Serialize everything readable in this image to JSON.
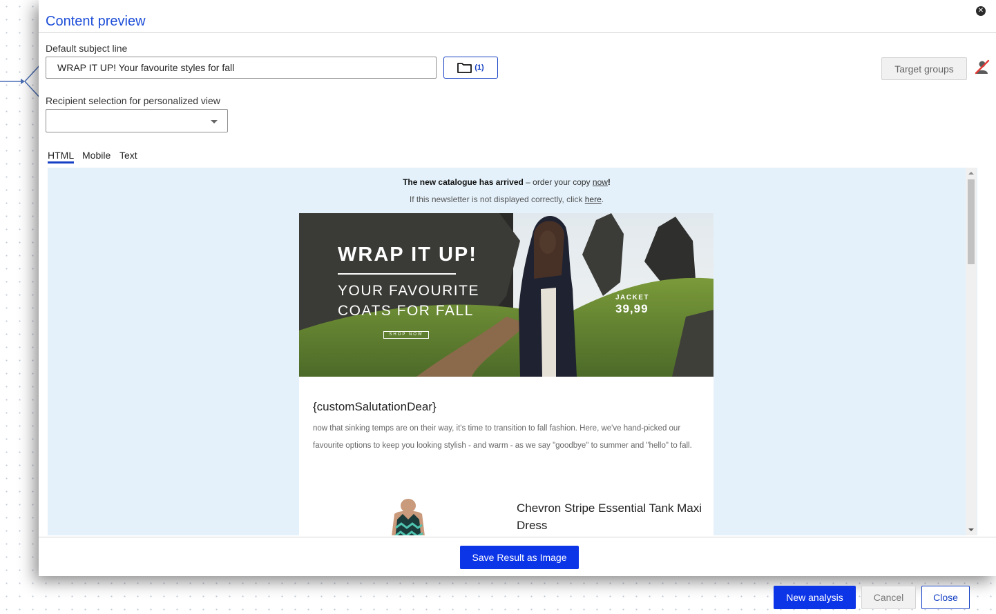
{
  "modal": {
    "title": "Content preview",
    "close_icon": "close-circle-icon",
    "subject_label": "Default subject line",
    "subject_value": "WRAP IT UP! Your favourite styles for fall",
    "attachment_count": "(1)",
    "attachment_icon": "folder-icon",
    "target_groups_label": "Target groups",
    "user_icon": "user-blocked-icon",
    "recipient_label": "Recipient selection for personalized view",
    "recipient_value": "",
    "tabs": [
      {
        "label": "HTML",
        "active": true
      },
      {
        "label": "Mobile",
        "active": false
      },
      {
        "label": "Text",
        "active": false
      }
    ],
    "save_button": "Save Result as Image"
  },
  "email": {
    "topline_bold": "The new catalogue has arrived",
    "topline_mid": " – order your copy ",
    "topline_link": "now",
    "topline_end": "!",
    "note_text": "If this newsletter is not displayed correctly, click ",
    "note_link": "here",
    "note_end": ".",
    "hero": {
      "headline": "WRAP IT UP!",
      "sub1": "YOUR FAVOURITE",
      "sub2": "COATS FOR FALL",
      "shop": "SHOP NOW",
      "jacket": "JACKET",
      "price": "39,99"
    },
    "salutation": "{customSalutationDear}",
    "body": "now that sinking temps are on their way, it's time to transition to fall fashion. Here, we've hand-picked our favourite options to keep you looking stylish - and warm - as we say \"goodbye\" to summer and \"hello\" to fall.",
    "product_name": "Chevron Stripe Essential Tank Maxi Dress"
  },
  "footer": {
    "new_analysis": "New analysis",
    "cancel": "Cancel",
    "close": "Close"
  },
  "colors": {
    "accent": "#0d35e8",
    "title": "#1d4ed8",
    "preview_bg": "#e4f1fa"
  }
}
